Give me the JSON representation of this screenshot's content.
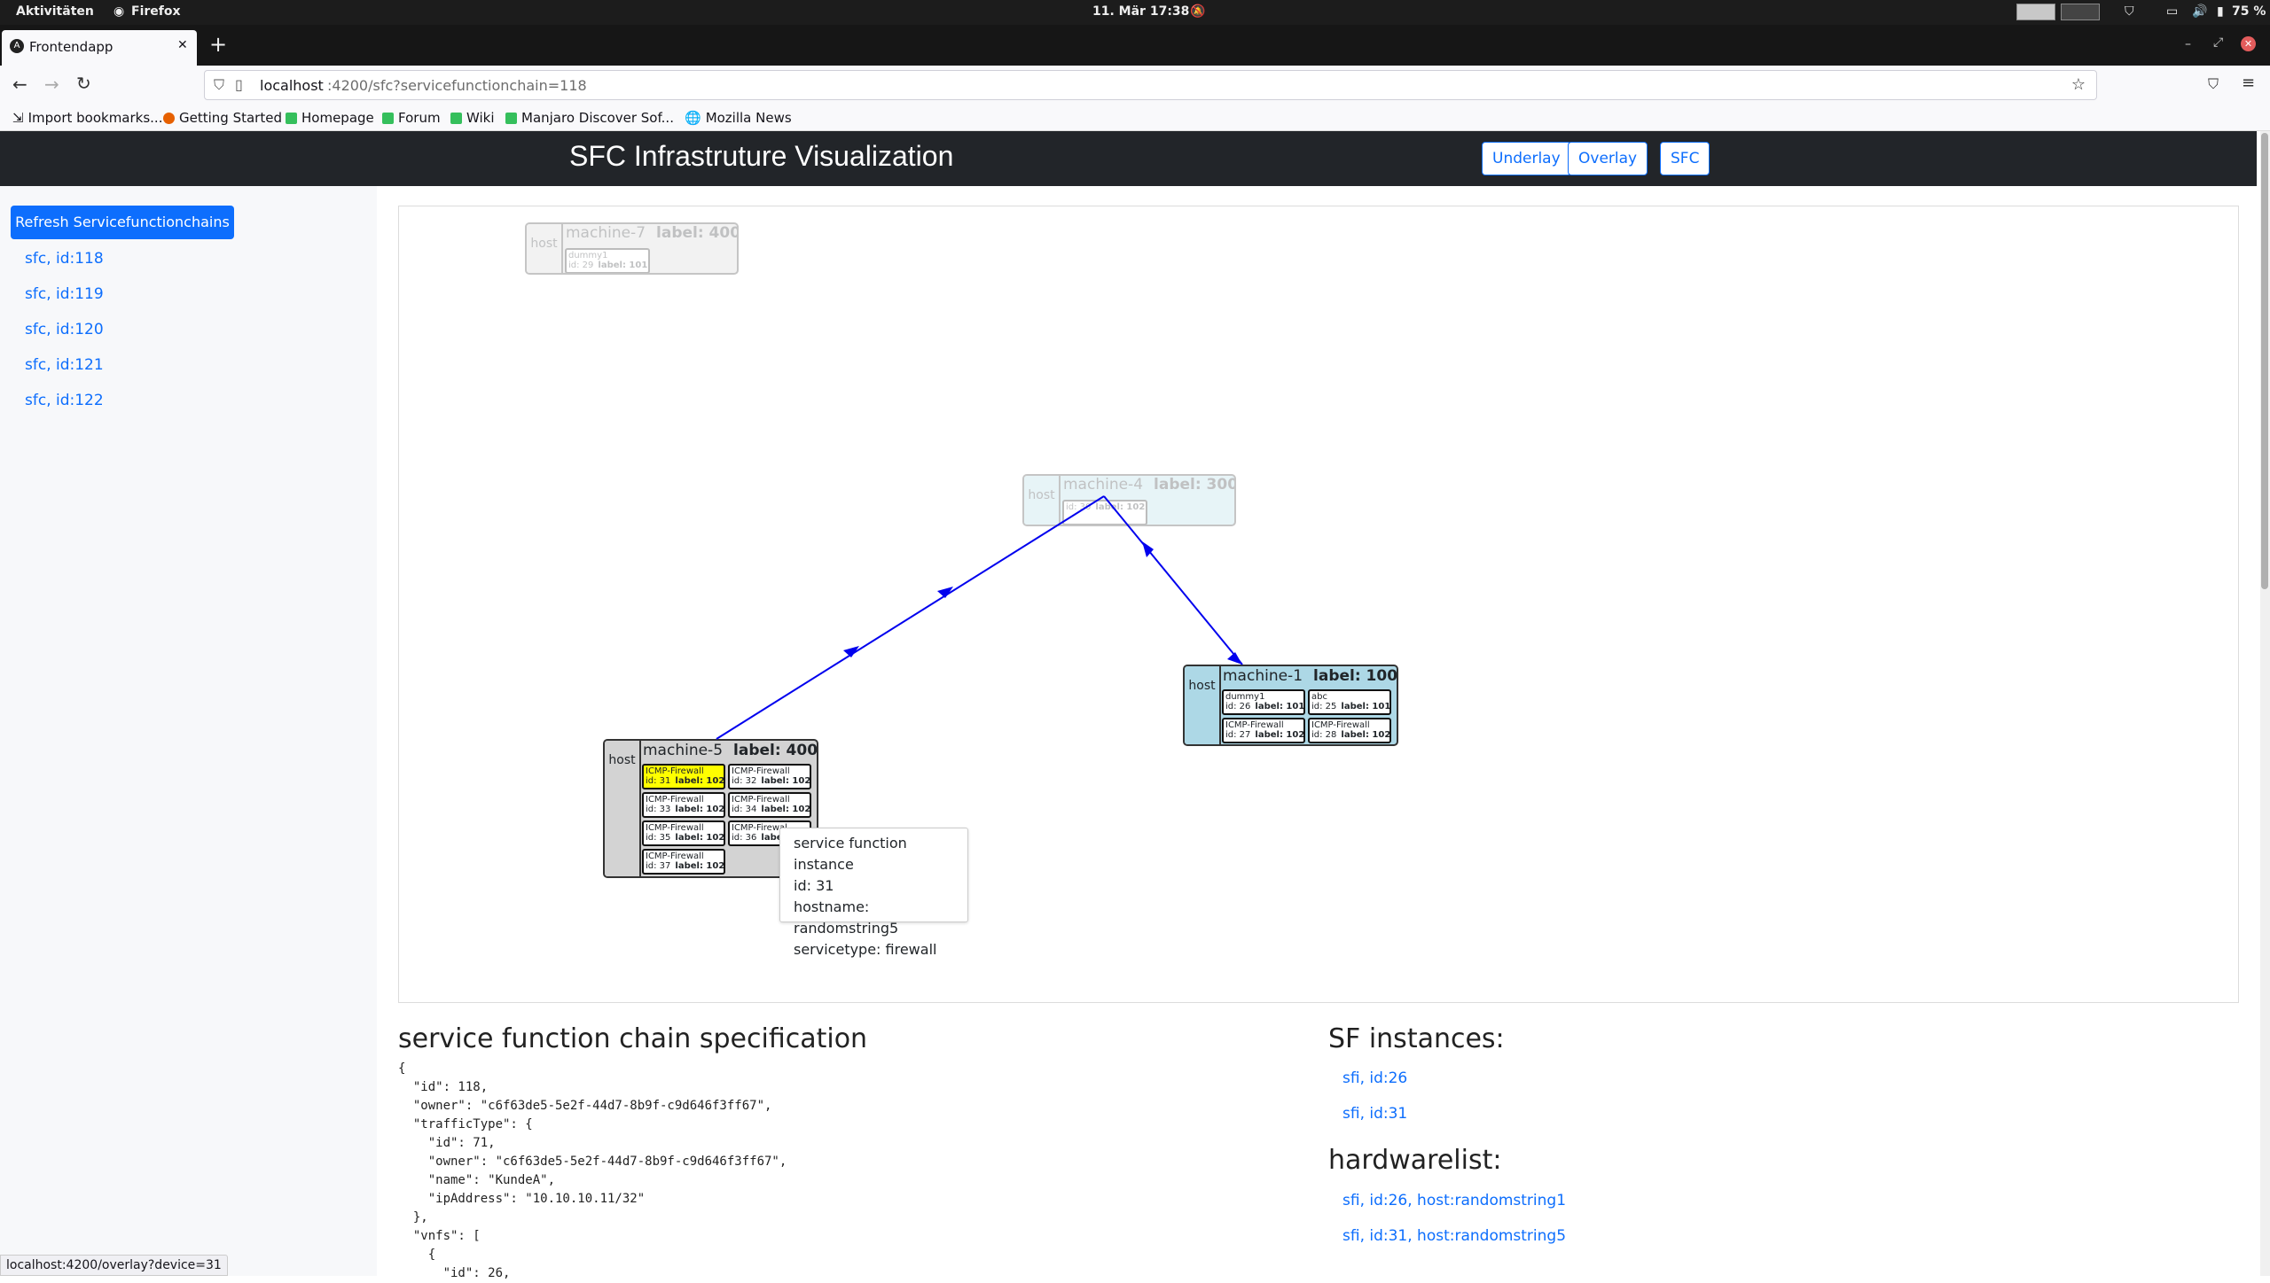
{
  "os_bar": {
    "activities": "Aktivitäten",
    "app": "Firefox",
    "datetime": "11. Mär  17:38",
    "battery": "75 %"
  },
  "browser": {
    "tab_title": "Frontendapp",
    "new_tab": "+",
    "url_host": "localhost",
    "url_path": ":4200/sfc?servicefunctionchain=118",
    "bookmarks": [
      "Import bookmarks...",
      "Getting Started",
      "Homepage",
      "Forum",
      "Wiki",
      "Manjaro Discover Sof...",
      "Mozilla News"
    ]
  },
  "app": {
    "title": "SFC Infrastruture Visualization",
    "nav": [
      "Underlay",
      "Overlay",
      "SFC"
    ]
  },
  "sidebar": {
    "refresh_label": "Refresh Servicefunctionchains",
    "chains": [
      "sfc, id:118",
      "sfc, id:119",
      "sfc, id:120",
      "sfc, id:121",
      "sfc, id:122"
    ]
  },
  "graph": {
    "host_label": "host",
    "machine7": {
      "name": "machine-7",
      "label": "label: 400",
      "vnf": {
        "name": "dummy1",
        "id": "id: 29",
        "label": "label: 101"
      }
    },
    "machine4": {
      "name": "machine-4",
      "label": "label: 300",
      "vnf": {
        "name": "",
        "id": "id: 30",
        "label": "label: 102"
      }
    },
    "machine1": {
      "name": "machine-1",
      "label": "label: 100",
      "vnfs": [
        {
          "name": "dummy1",
          "id": "id: 26",
          "label": "label: 101"
        },
        {
          "name": "abc",
          "id": "id: 25",
          "label": "label: 101"
        },
        {
          "name": "ICMP-Firewall",
          "id": "id: 27",
          "label": "label: 102"
        },
        {
          "name": "ICMP-Firewall",
          "id": "id: 28",
          "label": "label: 102"
        }
      ]
    },
    "machine5": {
      "name": "machine-5",
      "label": "label: 400",
      "vnfs": [
        {
          "name": "ICMP-Firewall",
          "id": "id: 31",
          "label": "label: 102"
        },
        {
          "name": "ICMP-Firewall",
          "id": "id: 32",
          "label": "label: 102"
        },
        {
          "name": "ICMP-Firewall",
          "id": "id: 33",
          "label": "label: 102"
        },
        {
          "name": "ICMP-Firewall",
          "id": "id: 34",
          "label": "label: 102"
        },
        {
          "name": "ICMP-Firewall",
          "id": "id: 35",
          "label": "label: 102"
        },
        {
          "name": "ICMP-Firewal",
          "id": "id: 36",
          "label": "label: 102"
        },
        {
          "name": "ICMP-Firewall",
          "id": "id: 37",
          "label": "label: 102"
        }
      ]
    },
    "tooltip": [
      "service function instance",
      "id: 31",
      "hostname: randomstring5",
      "servicetype: firewall"
    ],
    "colors": {
      "edge": "#0000ee",
      "highlight": "#ffff00",
      "host_blue": "#add8e6",
      "host_grey": "#d3d3d3"
    }
  },
  "spec": {
    "heading": "service function chain specification",
    "json_lines": [
      "{",
      "  \"id\": 118,",
      "  \"owner\": \"c6f63de5-5e2f-44d7-8b9f-c9d646f3ff67\",",
      "  \"trafficType\": {",
      "    \"id\": 71,",
      "    \"owner\": \"c6f63de5-5e2f-44d7-8b9f-c9d646f3ff67\",",
      "    \"name\": \"KundeA\",",
      "    \"ipAddress\": \"10.10.10.11/32\"",
      "  },",
      "  \"vnfs\": [",
      "    {",
      "      \"id\": 26,"
    ]
  },
  "sf_instances": {
    "heading": "SF instances:",
    "items": [
      "sfi, id:26",
      "sfi, id:31"
    ]
  },
  "hardwarelist": {
    "heading": "hardwarelist:",
    "items": [
      "sfi, id:26, host:randomstring1",
      "sfi, id:31, host:randomstring5"
    ]
  },
  "status_url": "localhost:4200/overlay?device=31"
}
